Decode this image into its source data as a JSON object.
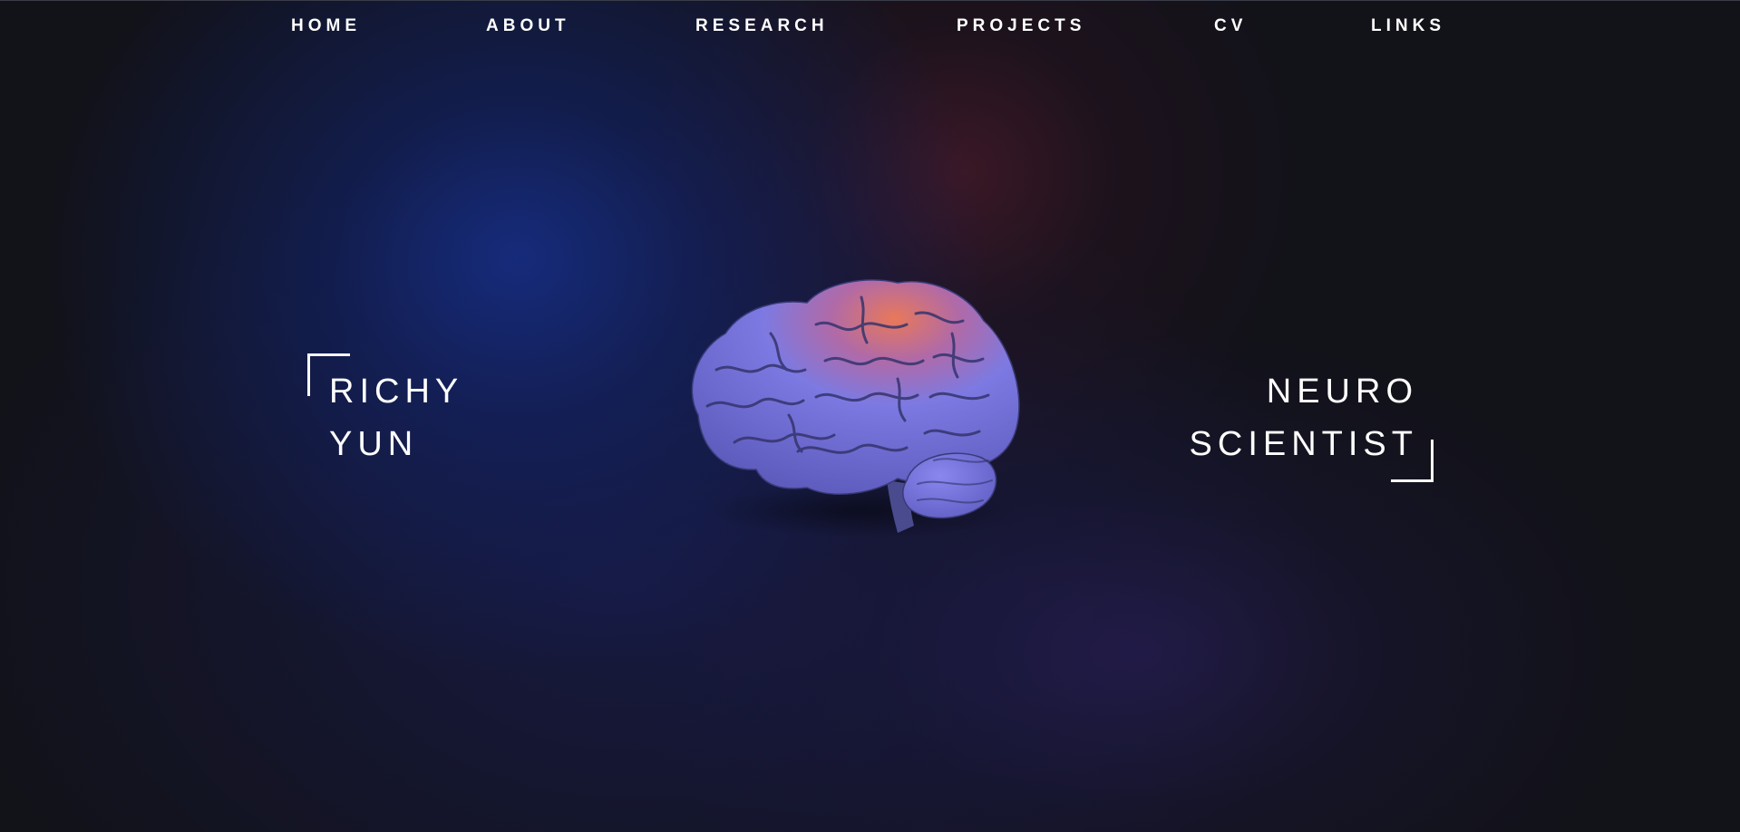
{
  "nav": {
    "items": [
      {
        "label": "HOME"
      },
      {
        "label": "ABOUT"
      },
      {
        "label": "RESEARCH"
      },
      {
        "label": "PROJECTS"
      },
      {
        "label": "CV"
      },
      {
        "label": "LINKS"
      }
    ]
  },
  "hero": {
    "name_line1": "RICHY",
    "name_line2": "YUN",
    "title_line1": "NEURO",
    "title_line2": "SCIENTIST"
  },
  "colors": {
    "background": "#121219",
    "text": "#ffffff",
    "glow_blue": "#16307f",
    "glow_red": "#5c1c30",
    "brain_lavender": "#7a78e0",
    "brain_highlight": "#e8785a"
  },
  "icons": {
    "center_image": "brain-image"
  }
}
